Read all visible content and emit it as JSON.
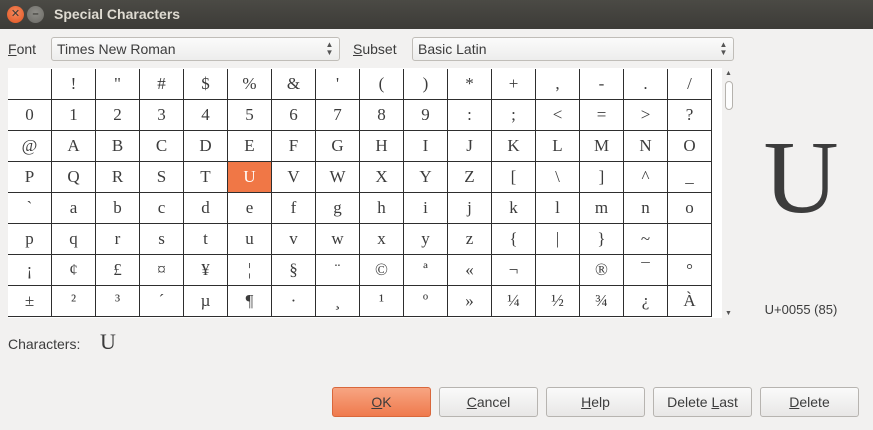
{
  "window": {
    "title": "Special Characters"
  },
  "font": {
    "label": "Font",
    "mnemonic": "F",
    "value": "Times New Roman"
  },
  "subset": {
    "label": "Subset",
    "mnemonic": "S",
    "value": "Basic Latin"
  },
  "grid": {
    "selected_index": 53,
    "cells": [
      " ",
      "!",
      "\"",
      "#",
      "$",
      "%",
      "&",
      "'",
      "(",
      ")",
      "*",
      "+",
      ",",
      "-",
      ".",
      "/",
      "0",
      "1",
      "2",
      "3",
      "4",
      "5",
      "6",
      "7",
      "8",
      "9",
      ":",
      ";",
      "<",
      "=",
      ">",
      "?",
      "@",
      "A",
      "B",
      "C",
      "D",
      "E",
      "F",
      "G",
      "H",
      "I",
      "J",
      "K",
      "L",
      "M",
      "N",
      "O",
      "P",
      "Q",
      "R",
      "S",
      "T",
      "U",
      "V",
      "W",
      "X",
      "Y",
      "Z",
      "[",
      "\\",
      "]",
      "^",
      "_",
      "`",
      "a",
      "b",
      "c",
      "d",
      "e",
      "f",
      "g",
      "h",
      "i",
      "j",
      "k",
      "l",
      "m",
      "n",
      "o",
      "p",
      "q",
      "r",
      "s",
      "t",
      "u",
      "v",
      "w",
      "x",
      "y",
      "z",
      "{",
      "|",
      "}",
      "~",
      " ",
      "¡",
      "¢",
      "£",
      "¤",
      "¥",
      "¦",
      "§",
      "¨",
      "©",
      "ª",
      "«",
      "¬",
      "",
      "®",
      "¯",
      "°",
      "±",
      "²",
      "³",
      "´",
      "µ",
      "¶",
      "·",
      "¸",
      "¹",
      "º",
      "»",
      "¼",
      "½",
      "¾",
      "¿",
      "À"
    ]
  },
  "preview": {
    "glyph": "U",
    "code": "U+0055 (85)"
  },
  "characters": {
    "label": "Characters:",
    "value": "U"
  },
  "buttons": {
    "ok": {
      "label": "OK",
      "mnemonic": "O"
    },
    "cancel": {
      "label": "Cancel",
      "mnemonic": "C"
    },
    "help": {
      "label": "Help",
      "mnemonic": "H"
    },
    "delete_last": {
      "label": "Delete Last",
      "mnemonic": "L"
    },
    "delete": {
      "label": "Delete",
      "mnemonic": "D"
    }
  },
  "icons": {
    "close": "close-icon",
    "minimize": "minimize-icon",
    "combo_arrows": "up-down-arrows-icon"
  }
}
